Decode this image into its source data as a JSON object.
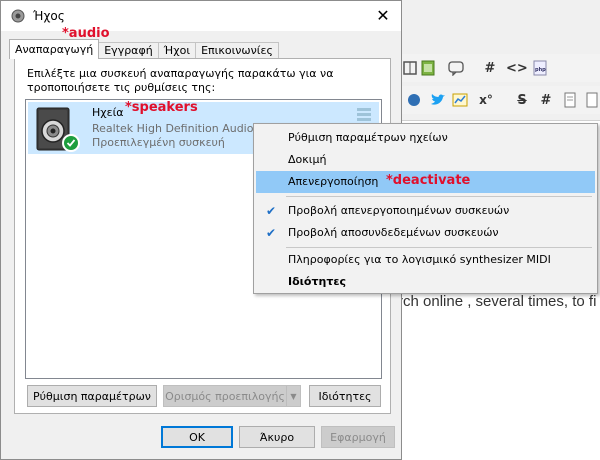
{
  "dialog": {
    "title": "Ήχος",
    "close_glyph": "✕",
    "tabs": [
      {
        "label": "Αναπαραγωγή",
        "active": true
      },
      {
        "label": "Εγγραφή",
        "active": false
      },
      {
        "label": "Ήχοι",
        "active": false
      },
      {
        "label": "Επικοινωνίες",
        "active": false
      }
    ],
    "instructions": "Επιλέξτε μια συσκευή αναπαραγωγής παρακάτω για να τροποποιήσετε τις ρυθμίσεις της:",
    "device": {
      "name": "Ηχεία",
      "driver": "Realtek High Definition Audio",
      "status": "Προεπιλεγμένη συσκευή",
      "icon": "speaker-icon",
      "badge_icon": "checkmark-icon"
    },
    "buttons": {
      "configure": "Ρύθμιση παραμέτρων",
      "set_default": "Ορισμός προεπιλογής",
      "properties": "Ιδιότητες",
      "ok": "OK",
      "cancel": "Άκυρο",
      "apply": "Εφαρμογή"
    }
  },
  "context_menu": {
    "items": [
      {
        "label": "Ρύθμιση παραμέτρων ηχείων",
        "checked": false,
        "highlighted": false,
        "bold": false
      },
      {
        "label": "Δοκιμή",
        "checked": false,
        "highlighted": false,
        "bold": false
      },
      {
        "label": "Απενεργοποίηση",
        "checked": false,
        "highlighted": true,
        "bold": false
      },
      {
        "label": "Προβολή απενεργοποιημένων συσκευών",
        "checked": true,
        "highlighted": false,
        "bold": false
      },
      {
        "label": "Προβολή αποσυνδεδεμένων συσκευών",
        "checked": true,
        "highlighted": false,
        "bold": false
      },
      {
        "label": "Πληροφορίες για το λογισμικό synthesizer MIDI",
        "checked": false,
        "highlighted": false,
        "bold": false
      },
      {
        "label": "Ιδιότητες",
        "checked": false,
        "highlighted": false,
        "bold": true
      }
    ],
    "check_glyph": "✔"
  },
  "annotations": {
    "audio": "*audio",
    "speakers": "*speakers",
    "deactivate": "*deactivate"
  },
  "background_editor": {
    "text_fragment": "rch online , several times, to fi",
    "toolbar_glyphs": [
      "#",
      "<>",
      "S",
      "#",
      "x°"
    ]
  },
  "colors": {
    "accent": "#0078d7",
    "selection": "#cce8ff",
    "menu_highlight": "#91c9f7",
    "annotation": "#e0102c",
    "check_green": "#1e9e3e"
  }
}
